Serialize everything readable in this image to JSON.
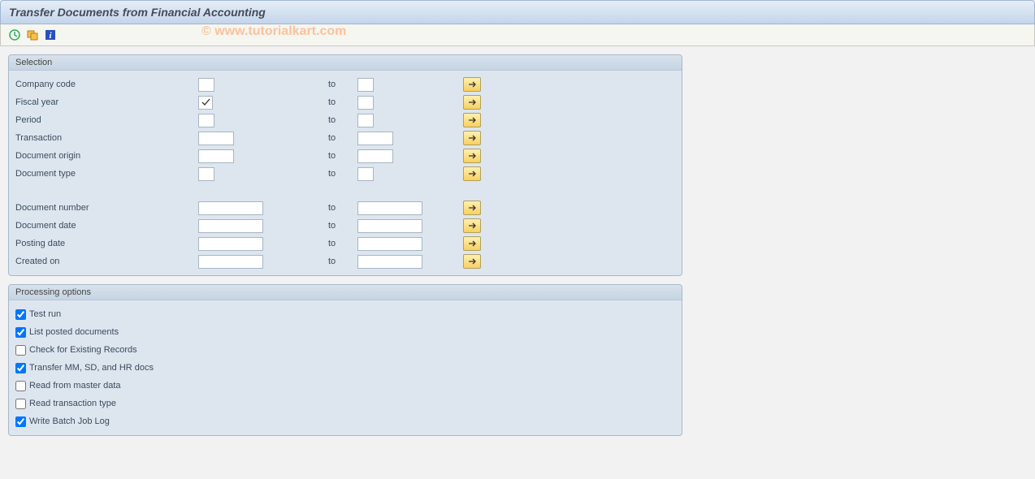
{
  "title": "Transfer Documents from Financial Accounting",
  "watermark": "© www.tutorialkart.com",
  "to_label": "to",
  "groups": {
    "selection": {
      "title": "Selection"
    },
    "processing": {
      "title": "Processing options"
    }
  },
  "fields": {
    "company_code": {
      "label": "Company code"
    },
    "fiscal_year": {
      "label": "Fiscal year",
      "checked": true
    },
    "period": {
      "label": "Period"
    },
    "transaction": {
      "label": "Transaction"
    },
    "doc_origin": {
      "label": "Document origin"
    },
    "doc_type": {
      "label": "Document type"
    },
    "doc_number": {
      "label": "Document number"
    },
    "doc_date": {
      "label": "Document date"
    },
    "posting_date": {
      "label": "Posting date"
    },
    "created_on": {
      "label": "Created on"
    }
  },
  "options": {
    "test_run": {
      "label": "Test run",
      "checked": true
    },
    "list_posted": {
      "label": "List posted documents",
      "checked": true
    },
    "check_existing": {
      "label": "Check for Existing Records",
      "checked": false
    },
    "transfer_mm": {
      "label": "Transfer MM, SD, and HR docs",
      "checked": true
    },
    "read_master": {
      "label": "Read from master data",
      "checked": false
    },
    "read_trans_type": {
      "label": "Read transaction type",
      "checked": false
    },
    "write_batch": {
      "label": "Write Batch Job Log",
      "checked": true
    }
  }
}
